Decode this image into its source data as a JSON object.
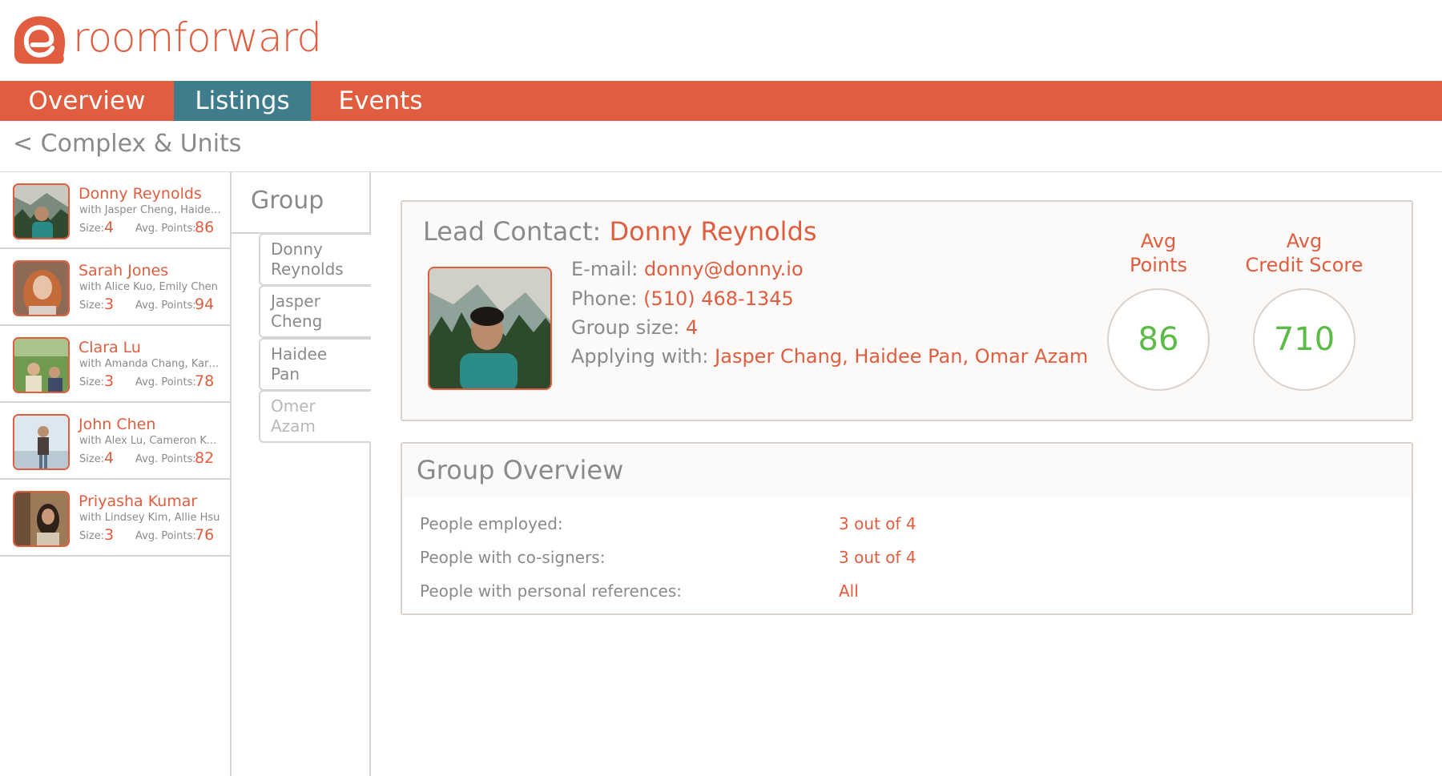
{
  "app": {
    "logo_text": "roomforward"
  },
  "nav": {
    "tabs": [
      {
        "label": "Overview"
      },
      {
        "label": "Listings"
      },
      {
        "label": "Events"
      }
    ],
    "active_tab": "Listings"
  },
  "breadcrumb": "< Complex & Units",
  "sidebar": {
    "groups": [
      {
        "name": "Donny Reynolds",
        "with": "with Jasper Cheng, Haidee P...",
        "size_label": "Size:",
        "size": "4",
        "points_label": "Avg. Points:",
        "points": "86"
      },
      {
        "name": "Sarah Jones",
        "with": "with Alice Kuo, Emily Chen",
        "size_label": "Size:",
        "size": "3",
        "points_label": "Avg. Points:",
        "points": "94"
      },
      {
        "name": "Clara Lu",
        "with": "with Amanda Chang, Karen...",
        "size_label": "Size:",
        "size": "3",
        "points_label": "Avg. Points:",
        "points": "78"
      },
      {
        "name": "John Chen",
        "with": "with Alex Lu, Cameron Kob...",
        "size_label": "Size:",
        "size": "4",
        "points_label": "Avg. Points:",
        "points": "82"
      },
      {
        "name": "Priyasha Kumar",
        "with": "with Lindsey Kim, Allie Hsu",
        "size_label": "Size:",
        "size": "3",
        "points_label": "Avg. Points:",
        "points": "76"
      }
    ]
  },
  "group_panel": {
    "title": "Group",
    "members": [
      {
        "first": "Donny",
        "last": "Reynolds"
      },
      {
        "first": "Jasper",
        "last": "Cheng"
      },
      {
        "first": "Haidee",
        "last": "Pan"
      },
      {
        "first": "Omer",
        "last": "Azam"
      }
    ]
  },
  "lead": {
    "title_prefix": "Lead Contact:",
    "name": "Donny Reynolds",
    "email_label": "E-mail:",
    "email": "donny@donny.io",
    "phone_label": "Phone:",
    "phone": "(510) 468-1345",
    "group_size_label": "Group size:",
    "group_size": "4",
    "applying_label": "Applying with:",
    "applying_with": "Jasper Chang, Haidee Pan, Omar Azam",
    "avg_points_label_1": "Avg",
    "avg_points_label_2": "Points",
    "avg_points": "86",
    "avg_credit_label_1": "Avg",
    "avg_credit_label_2": "Credit Score",
    "avg_credit": "710"
  },
  "overview": {
    "title": "Group Overview",
    "rows": [
      {
        "label": "People employed:",
        "value": "3 out of 4"
      },
      {
        "label": "People with co-signers:",
        "value": "3 out of 4"
      },
      {
        "label": "People with personal references:",
        "value": "All"
      }
    ]
  },
  "colors": {
    "accent": "#e05d3f",
    "active_tab": "#3f7d8c",
    "score_green": "#5cba47",
    "text_gray": "#8a8a8a",
    "border": "#d5d5d5"
  }
}
